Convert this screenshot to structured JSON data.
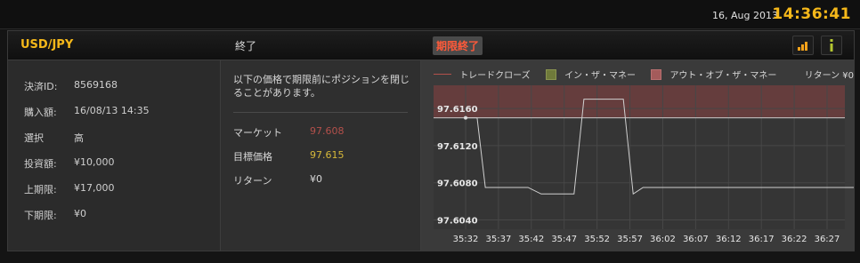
{
  "topbar": {
    "date": "16, Aug 2013",
    "time": "14:36:41"
  },
  "header": {
    "pair": "USD/JPY",
    "status": "終了",
    "badge": "期限終了",
    "icons": [
      "signal-bars-icon",
      "info-icon"
    ]
  },
  "details": [
    {
      "label": "決済ID:",
      "value": "8569168"
    },
    {
      "label": "購入額:",
      "value": "16/08/13 14:35"
    },
    {
      "label": "選択",
      "value": "高"
    },
    {
      "label": "投資額:",
      "value": "¥10,000"
    },
    {
      "label": "上期限:",
      "value": "¥17,000"
    },
    {
      "label": "下期限:",
      "value": "¥0"
    }
  ],
  "summary": {
    "note": "以下の価格で期限前にポジションを閉じることがあります。",
    "rows": [
      {
        "label": "マーケット",
        "value": "97.608",
        "color": "#b3504b"
      },
      {
        "label": "目標価格",
        "value": "97.615",
        "color": "#d6b83a"
      },
      {
        "label": "リターン",
        "value": "¥0",
        "color": "#d8d8d8"
      }
    ]
  },
  "legend": {
    "trade_close": "トレードクローズ",
    "in_the_money": "イン・ザ・マネー",
    "out_of_money": "アウト・オブ・ザ・マネー",
    "return": "リターン ¥0",
    "colors": {
      "line": "#b3504b",
      "in": "#6f7a3a",
      "out": "#a45b5b"
    }
  },
  "chart_data": {
    "type": "line",
    "x": [
      "35:32",
      "35:37",
      "35:42",
      "35:47",
      "35:52",
      "35:57",
      "36:02",
      "36:07",
      "36:12",
      "36:17",
      "36:22",
      "36:27"
    ],
    "y_ticks": [
      "97.6040",
      "97.6080",
      "97.6120",
      "97.6160"
    ],
    "ylim": [
      97.603,
      97.6185
    ],
    "target": 97.615,
    "series": [
      {
        "points": [
          [
            0,
            97.615
          ],
          [
            0.35,
            97.615
          ],
          [
            0.6,
            97.6075
          ],
          [
            1.9,
            97.6075
          ],
          [
            2.3,
            97.6068
          ],
          [
            3.3,
            97.6068
          ],
          [
            3.6,
            97.617
          ],
          [
            4.8,
            97.617
          ],
          [
            5.1,
            97.6068
          ],
          [
            5.4,
            97.6075
          ],
          [
            11.9,
            97.6075
          ]
        ]
      }
    ]
  }
}
